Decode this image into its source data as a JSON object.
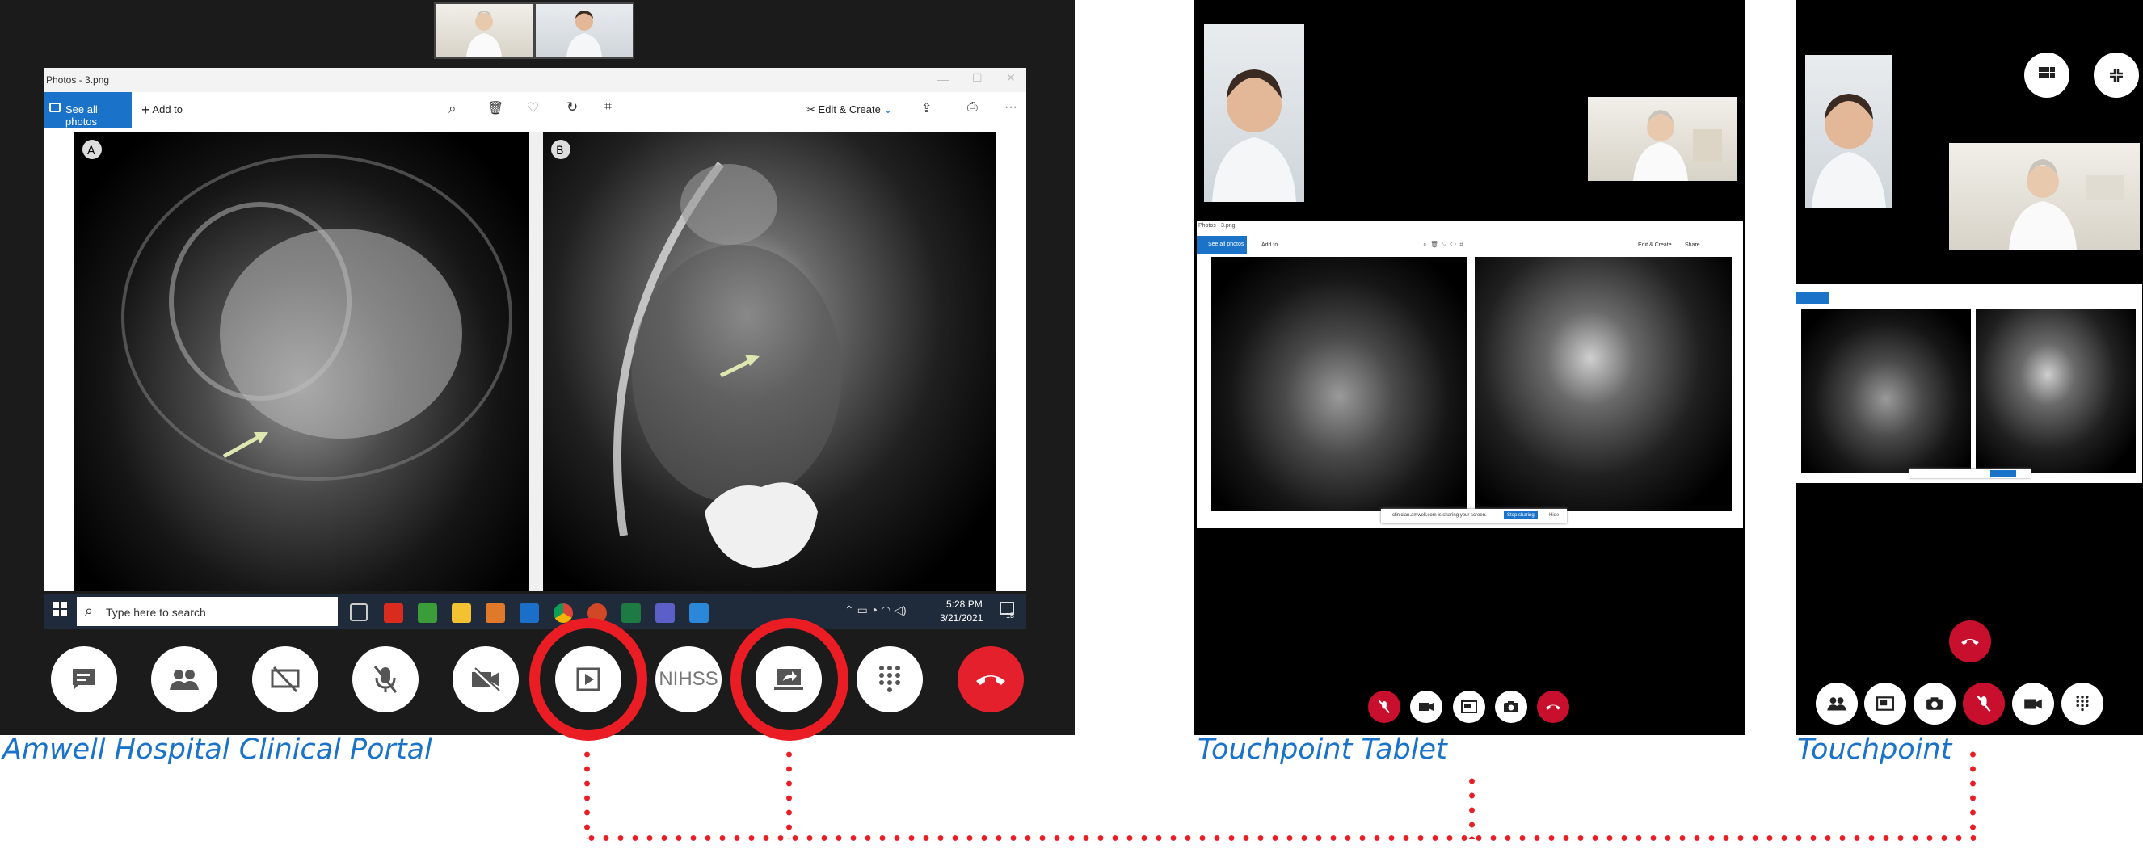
{
  "captions": {
    "portal": "Amwell Hospital Clinical Portal",
    "tablet": "Touchpoint Tablet",
    "touchpoint": "Touchpoint"
  },
  "photos_app": {
    "title": "Photos - 3.png",
    "see_all": "See all photos",
    "add_to": "Add to",
    "edit_create": "Edit & Create",
    "more": "···",
    "panel_a": "A",
    "panel_b": "B"
  },
  "taskbar": {
    "search_placeholder": "Type here to search",
    "time": "5:28 PM",
    "date": "3/21/2021",
    "notifications": "15"
  },
  "portal_controls": {
    "nihss": "NIHSS",
    "icons": [
      "chat-icon",
      "people-icon",
      "screen-share-off-icon",
      "mic-off-icon",
      "video-off-icon",
      "play-media-icon",
      "nihss",
      "share-screen-icon",
      "keypad-icon",
      "end-call-icon"
    ]
  },
  "tablet_mini": {
    "title": "Photos - 3.png",
    "see_all": "See all photos",
    "add_to": "Add to",
    "edit_create": "Edit & Create",
    "share": "Share",
    "sharing_banner": "clinician.amwell.com is sharing your screen.",
    "stop_sharing": "Stop sharing",
    "hide": "Hide"
  },
  "colors": {
    "accent_blue": "#1a73c9",
    "annotation_red": "#ea1c24",
    "end_call_red": "#e3202b",
    "touchpoint_red": "#c8102e"
  }
}
